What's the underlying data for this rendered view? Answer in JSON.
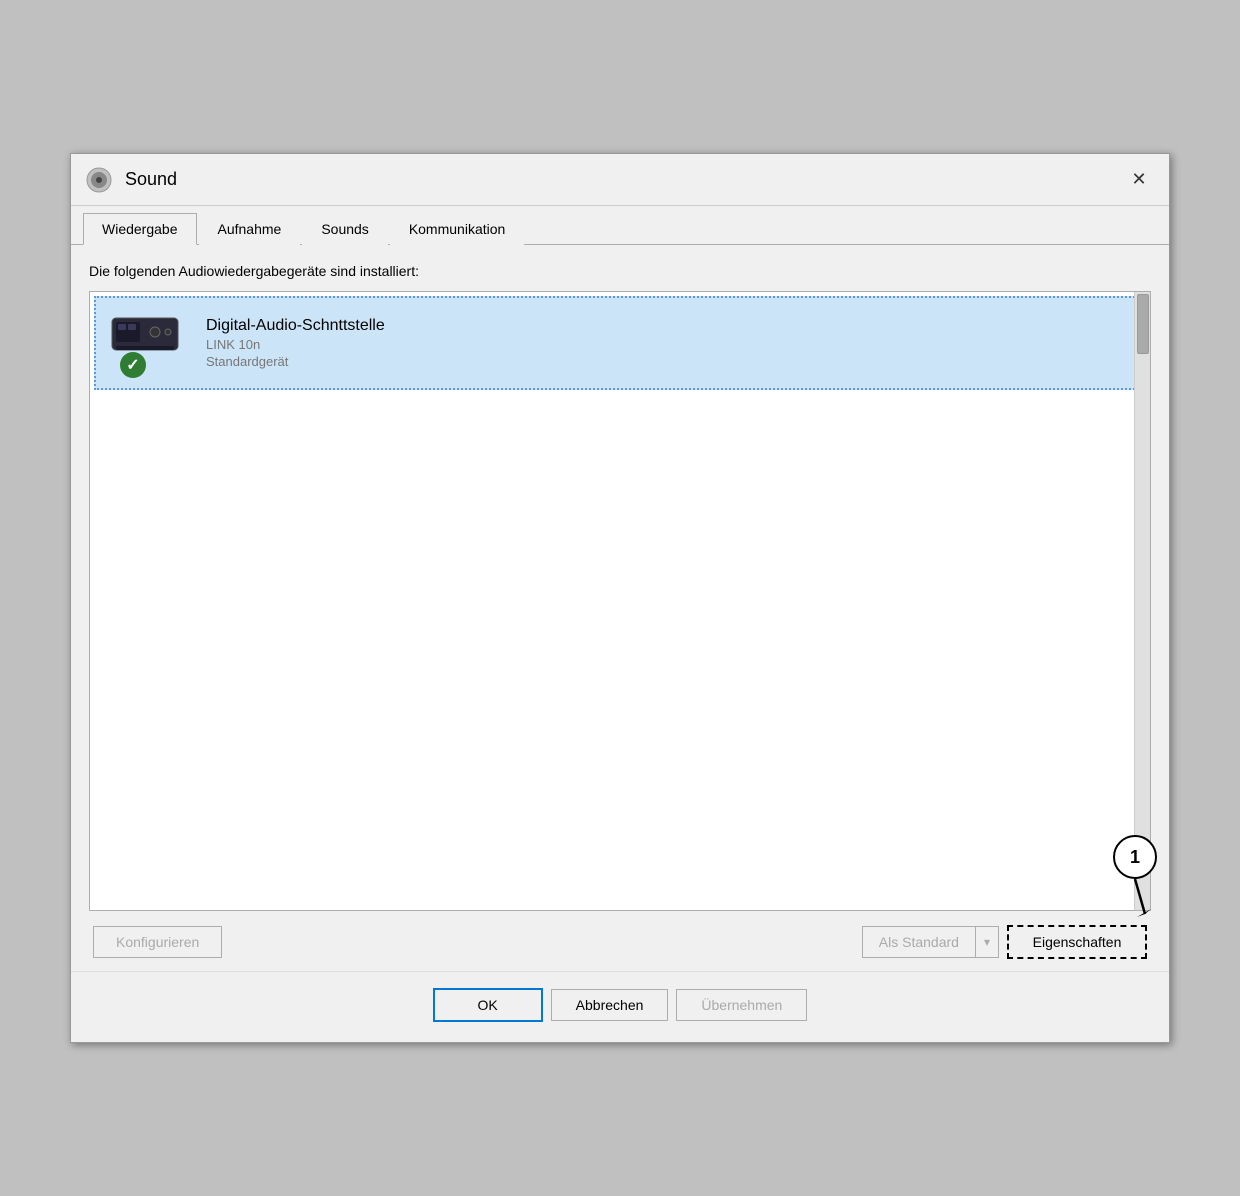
{
  "window": {
    "title": "Sound",
    "close_label": "✕"
  },
  "tabs": [
    {
      "id": "wiedergabe",
      "label": "Wiedergabe",
      "active": true
    },
    {
      "id": "aufnahme",
      "label": "Aufnahme",
      "active": false
    },
    {
      "id": "sounds",
      "label": "Sounds",
      "active": false
    },
    {
      "id": "kommunikation",
      "label": "Kommunikation",
      "active": false
    }
  ],
  "description": "Die folgenden Audiowiedergabegeräte sind installiert:",
  "device": {
    "name": "Digital-Audio-Schnttstelle",
    "sub1": "LINK 10n",
    "sub2": "Standardgerät"
  },
  "buttons": {
    "konfigurieren": "Konfigurieren",
    "als_standard": "Als Standard",
    "eigenschaften": "Eigenschaften",
    "ok": "OK",
    "abbrechen": "Abbrechen",
    "uebernehmen": "Übernehmen"
  },
  "annotation": {
    "number": "1"
  }
}
